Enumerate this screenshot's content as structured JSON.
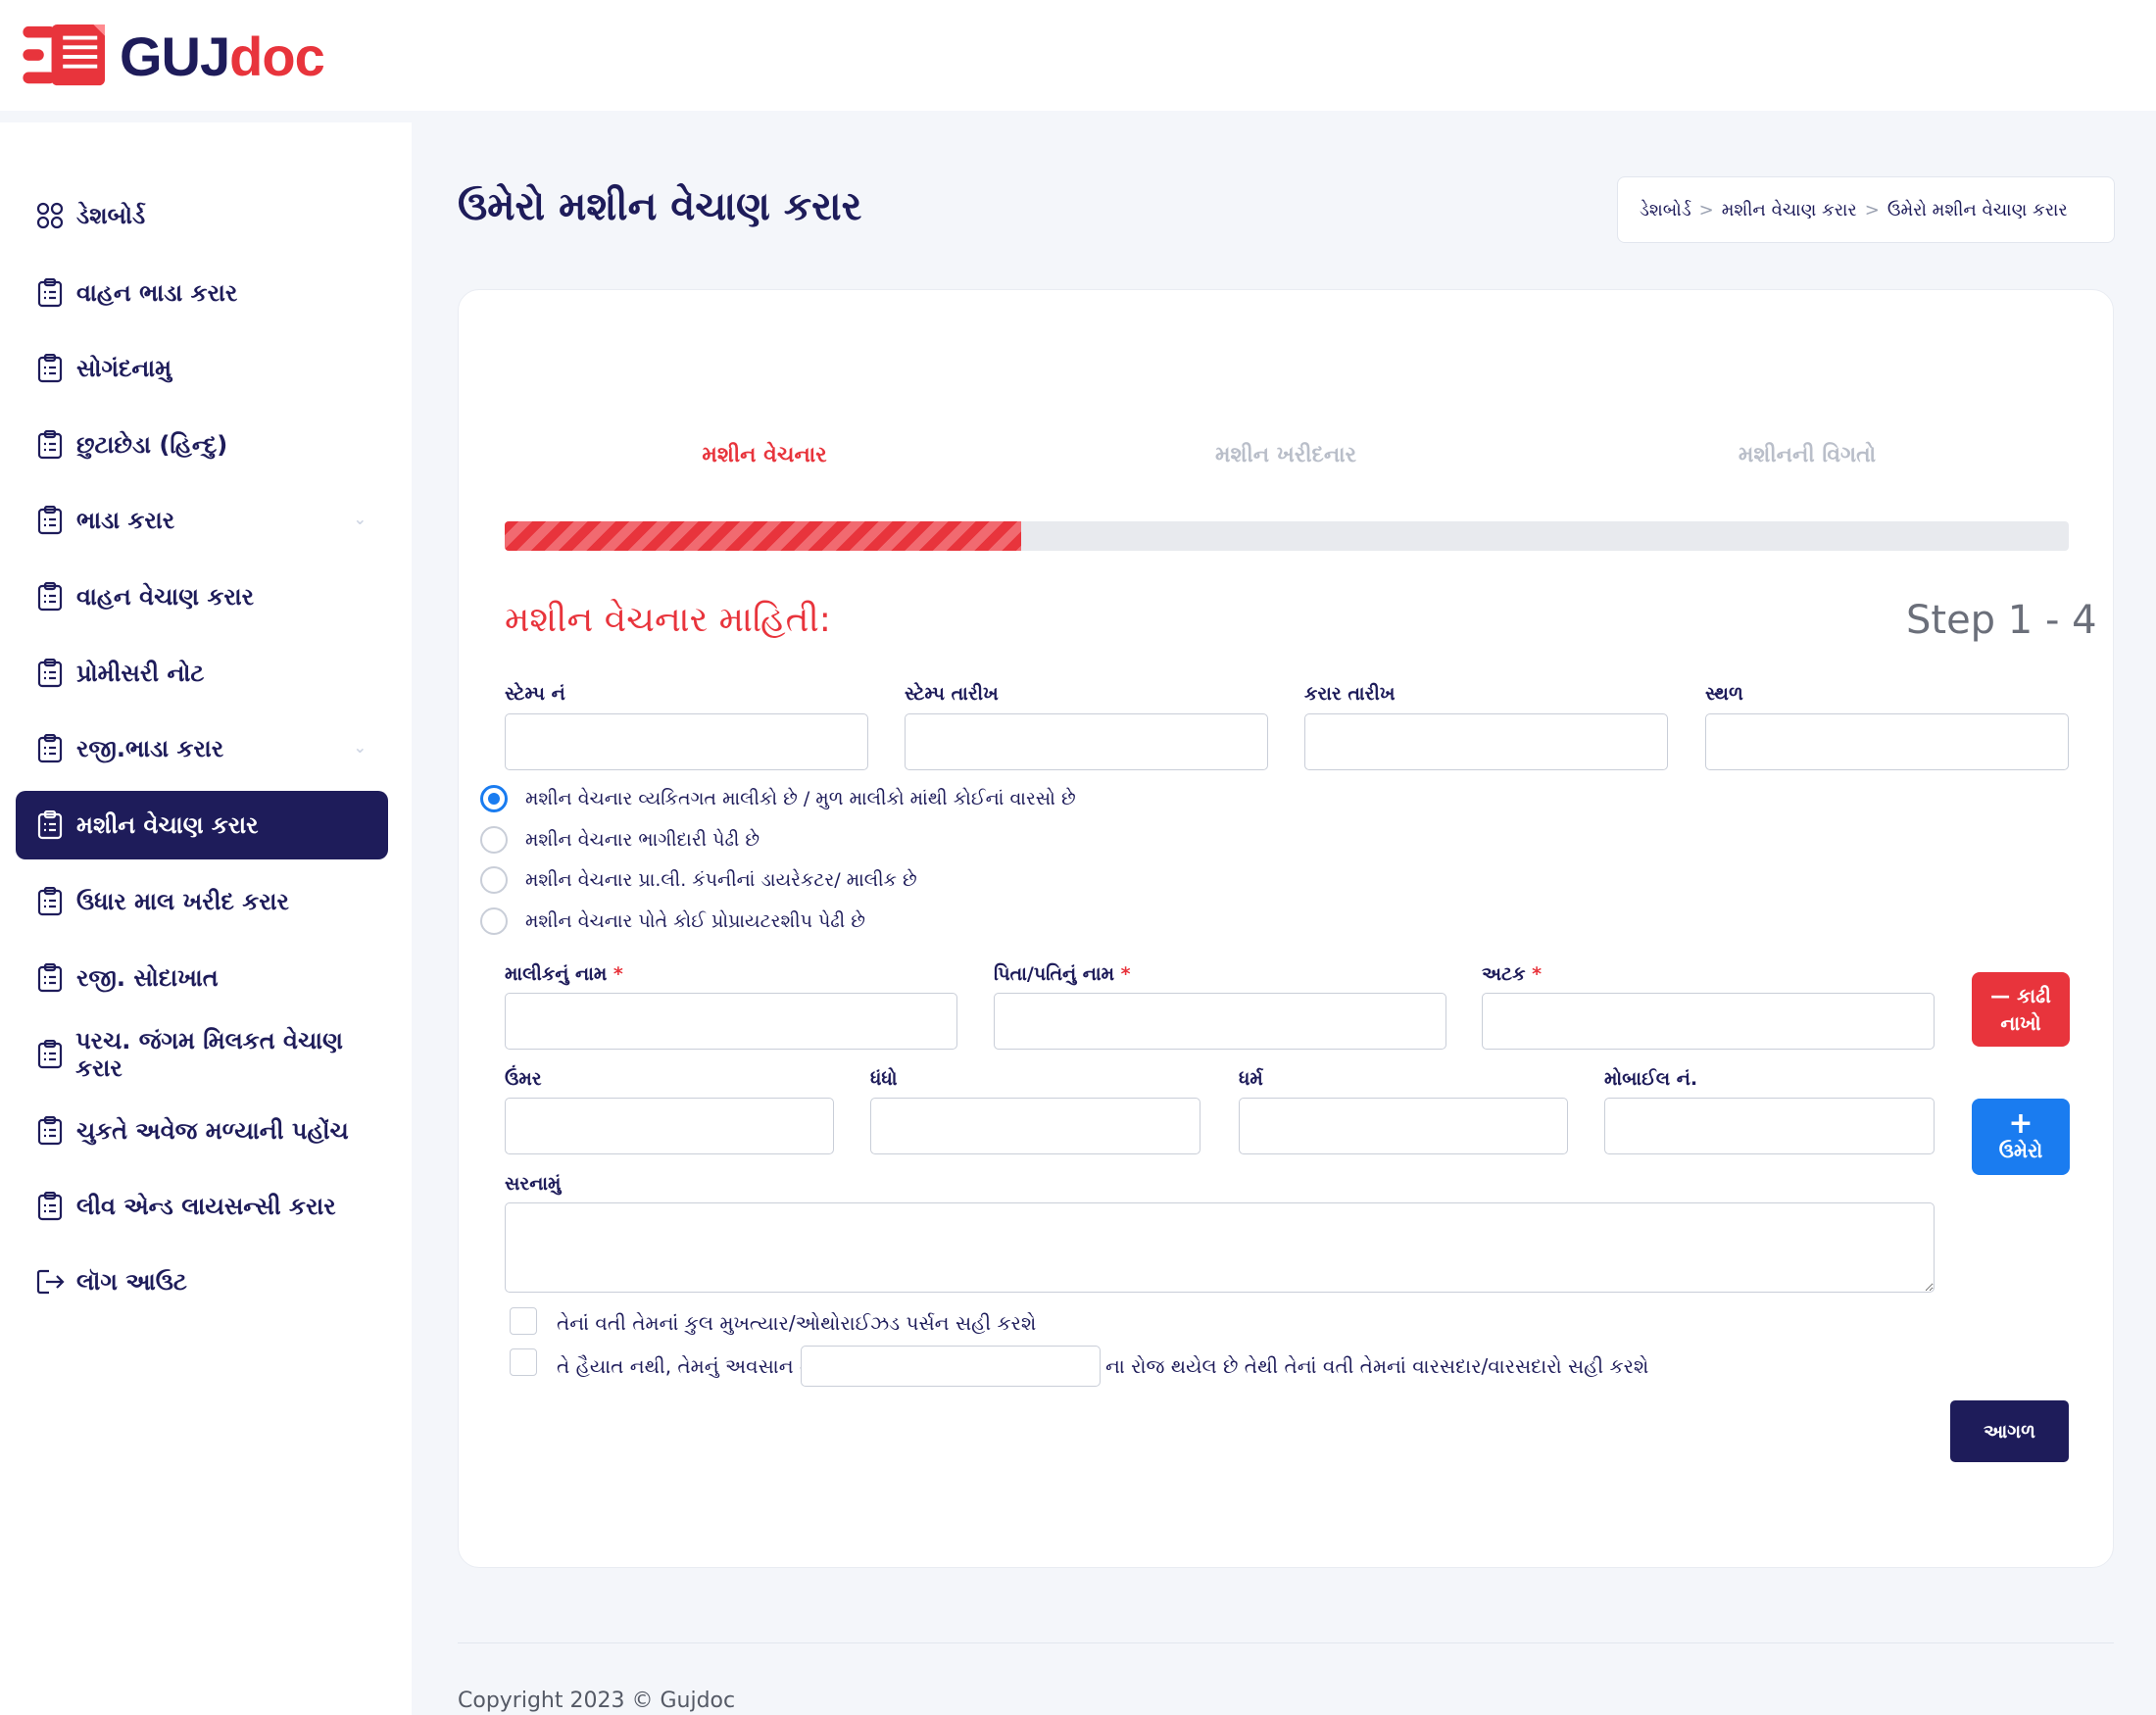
{
  "brand": {
    "name_part1": "GUJ",
    "name_part2": "doc"
  },
  "colors": {
    "primary": "#1e1c5a",
    "accent": "#e8343c",
    "blue": "#1a7cf0",
    "muted": "#b9bec9"
  },
  "sidebar": {
    "items": [
      {
        "label": "ડેશબોર્ડ",
        "icon": "dashboard-grid-icon"
      },
      {
        "label": "વાહન ભાડા કરાર",
        "icon": "clipboard-icon"
      },
      {
        "label": "સોગંદનામુ",
        "icon": "clipboard-icon"
      },
      {
        "label": "છુટાછેડા (હિન્દુ)",
        "icon": "clipboard-icon"
      },
      {
        "label": "ભાડા કરાર",
        "icon": "clipboard-icon",
        "chevron": "⌄"
      },
      {
        "label": "વાહન વેચાણ કરાર",
        "icon": "clipboard-icon"
      },
      {
        "label": "પ્રોમીસરી નોટ",
        "icon": "clipboard-icon"
      },
      {
        "label": "રજી.ભાડા કરાર",
        "icon": "clipboard-icon",
        "chevron": "⌄"
      },
      {
        "label": "મશીન વેચાણ કરાર",
        "icon": "clipboard-icon",
        "active": true
      },
      {
        "label": "ઉધાર માલ ખરીદ કરાર",
        "icon": "clipboard-icon"
      },
      {
        "label": "રજી. સોદાખાત",
        "icon": "clipboard-icon"
      },
      {
        "label": "પરચ. જંગમ મિલકત વેચાણ કરાર",
        "icon": "clipboard-icon"
      },
      {
        "label": "ચુકતે અવેજ મળ્યાની પહોંચ",
        "icon": "clipboard-icon"
      },
      {
        "label": "લીવ એન્ડ લાયસન્સી કરાર",
        "icon": "clipboard-icon"
      },
      {
        "label": "લૉગ આઉટ",
        "icon": "logout-icon"
      }
    ]
  },
  "header": {
    "title": "ઉમેરો મશીન વેચાણ કરાર",
    "breadcrumb": [
      "ડેશબોર્ડ",
      "મશીન વેચાણ કરાર",
      "ઉમેરો મશીન વેચાણ કરાર"
    ],
    "breadcrumb_sep": ">"
  },
  "wizard": {
    "steps": [
      {
        "label": "મશીન વેચનાર",
        "active": true
      },
      {
        "label": "મશીન ખરીદનાર",
        "active": false
      },
      {
        "label": "મશીનની વિગતો",
        "active": false
      }
    ],
    "progress": 0.33,
    "section_title": "મશીન વેચનાર માહિતી:",
    "step_count": "Step 1 - 4"
  },
  "form": {
    "row1": [
      {
        "label": "સ્ટેમ્પ નં",
        "value": ""
      },
      {
        "label": "સ્ટેમ્પ તારીખ",
        "value": ""
      },
      {
        "label": "કરાર તારીખ",
        "value": ""
      },
      {
        "label": "સ્થળ",
        "value": ""
      }
    ],
    "radios": [
      {
        "label": "મશીન વેચનાર વ્યકિતગત માલીકો છે / મુળ માલીકો માંથી કોઈનાં વારસો છે",
        "checked": true
      },
      {
        "label": "મશીન વેચનાર ભાગીદારી પેઢી છે",
        "checked": false
      },
      {
        "label": "મશીન વેચનાર પ્રા.લી. કંપનીનાં ડાયરેકટર/ માલીક છે",
        "checked": false
      },
      {
        "label": "મશીન વેચનાર પોતે કોઈ પ્રોપ્રાયટરશીપ પેઢી છે",
        "checked": false
      }
    ],
    "owner_name": {
      "label": "માલીકનું નામ",
      "required": "*",
      "value": ""
    },
    "father_name": {
      "label": "પિતા/પતિનું નામ",
      "required": "*",
      "value": ""
    },
    "surname": {
      "label": "અટક",
      "required": "*",
      "value": ""
    },
    "age": {
      "label": "ઉંમર",
      "value": ""
    },
    "occupation": {
      "label": "ધંધો",
      "value": ""
    },
    "religion": {
      "label": "ધર્મ",
      "value": ""
    },
    "mobile": {
      "label": "મોબાઈલ નં.",
      "value": ""
    },
    "address": {
      "label": "સરનામું",
      "value": ""
    },
    "remove_button": {
      "line1": "— કાઢી",
      "line2": "નાખો"
    },
    "add_button": {
      "icon": "+",
      "label": "ઉમેરો"
    },
    "checkbox1": {
      "label": "તેનાં વતી તેમનાં કુલ મુખત્યાર/ઓથોરાઈઝડ પર્સન સહી કરશે",
      "checked": false
    },
    "checkbox2": {
      "label_before": "તે હૈયાત નથી, તેમનું અવસાન તા.",
      "label_after": "ના રોજ થયેલ છે તેથી તેનાં વતી તેમનાં વારસદાર/વારસદારો સહી કરશે",
      "date_value": "",
      "checked": false
    },
    "next_button": "આગળ"
  },
  "footer": {
    "copyright": "Copyright 2023 © Gujdoc"
  }
}
